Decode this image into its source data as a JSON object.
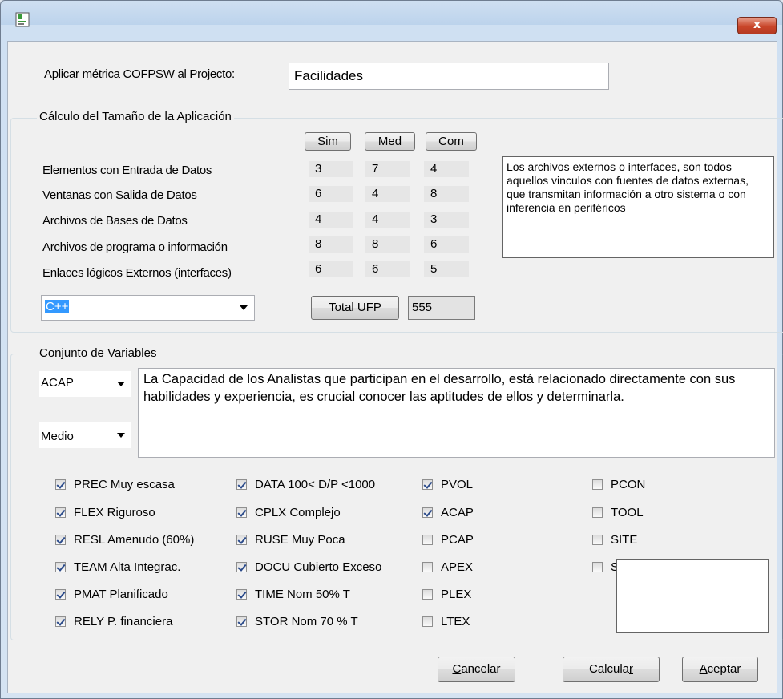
{
  "window": {
    "title": "",
    "close_symbol": "x"
  },
  "project": {
    "label": "Aplicar métrica COFPSW al Projecto:",
    "value": "Facilidades"
  },
  "size_group": {
    "title": "Cálculo del Tamaño de la Aplicación",
    "headers": [
      "Sim",
      "Med",
      "Com"
    ],
    "rows": [
      {
        "label": "Elementos con Entrada de Datos",
        "values": [
          "3",
          "7",
          "4"
        ]
      },
      {
        "label": "Ventanas con Salida de Datos",
        "values": [
          "6",
          "4",
          "8"
        ]
      },
      {
        "label": "Archivos de Bases de Datos",
        "values": [
          "4",
          "4",
          "3"
        ]
      },
      {
        "label": "Archivos de programa o información",
        "values": [
          "8",
          "8",
          "6"
        ]
      },
      {
        "label": "Enlaces lógicos Externos (interfaces)",
        "values": [
          "6",
          "6",
          "5"
        ]
      }
    ],
    "info_text": "Los archivos externos o interfaces, son todos aquellos vinculos con fuentes de datos externas, que transmitan información a otro sistema o con inferencia en periféricos",
    "language": "C++",
    "total_label": "Total UFP",
    "total_value": "555"
  },
  "variables_group": {
    "title": "Conjunto de Variables",
    "variable_select": "ACAP",
    "level_select": "Medio",
    "description": "La Capacidad de los Analistas que participan en el desarrollo, está relacionado directamente con sus habilidades y experiencia, es crucial conocer las aptitudes de ellos y determinarla.",
    "col1": [
      {
        "label": "PREC Muy escasa",
        "checked": true
      },
      {
        "label": "FLEX Riguroso",
        "checked": true
      },
      {
        "label": "RESL Amenudo (60%)",
        "checked": true
      },
      {
        "label": "TEAM Alta Integrac.",
        "checked": true
      },
      {
        "label": "PMAT Planificado",
        "checked": true
      },
      {
        "label": "RELY P. financiera",
        "checked": true
      }
    ],
    "col2": [
      {
        "label": "DATA 100< D/P <1000",
        "checked": true
      },
      {
        "label": "CPLX Complejo",
        "checked": true
      },
      {
        "label": "RUSE Muy Poca",
        "checked": true
      },
      {
        "label": "DOCU Cubierto Exceso",
        "checked": true
      },
      {
        "label": "TIME Nom 50% T",
        "checked": true
      },
      {
        "label": "STOR Nom 70 % T",
        "checked": true
      }
    ],
    "col3": [
      {
        "label": "PVOL",
        "checked": true
      },
      {
        "label": "ACAP",
        "checked": true
      },
      {
        "label": "PCAP",
        "checked": false
      },
      {
        "label": "APEX",
        "checked": false
      },
      {
        "label": "PLEX",
        "checked": false
      },
      {
        "label": "LTEX",
        "checked": false
      }
    ],
    "col4": [
      {
        "label": "PCON",
        "checked": false
      },
      {
        "label": "TOOL",
        "checked": false
      },
      {
        "label": "SITE",
        "checked": false
      },
      {
        "label": "S",
        "checked": false
      }
    ]
  },
  "buttons": {
    "cancel_first": "C",
    "cancel_rest": "ancelar",
    "calc_first": "Calcula",
    "calc_rest": "r",
    "accept_first": "A",
    "accept_rest": "ceptar"
  }
}
